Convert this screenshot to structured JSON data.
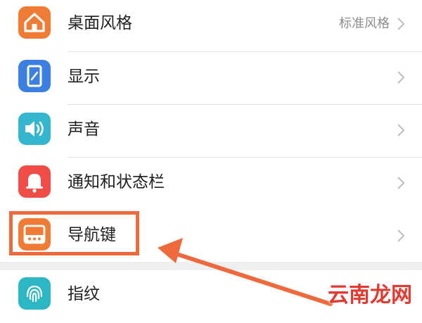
{
  "settings_list": {
    "items": [
      {
        "label": "桌面风格",
        "value": "标准风格",
        "icon": "home-icon",
        "icon_color": "#f07b35"
      },
      {
        "label": "显示",
        "value": "",
        "icon": "phone-display-icon",
        "icon_color": "#3b7fe0"
      },
      {
        "label": "声音",
        "value": "",
        "icon": "speaker-icon",
        "icon_color": "#34b6cf"
      },
      {
        "label": "通知和状态栏",
        "value": "",
        "icon": "bell-icon",
        "icon_color": "#ef4d45"
      },
      {
        "label": "导航键",
        "value": "",
        "icon": "navigation-keys-icon",
        "icon_color": "#f07b35"
      },
      {
        "label": "指纹",
        "value": "",
        "icon": "fingerprint-icon",
        "icon_color": "#2db7c4"
      }
    ]
  },
  "annotation": {
    "highlighted_item": "导航键",
    "highlight_color": "#ee6a3c",
    "arrow_color": "#ee6a3c"
  },
  "watermark": {
    "text": "云南龙网",
    "color": "#e23a2f"
  }
}
